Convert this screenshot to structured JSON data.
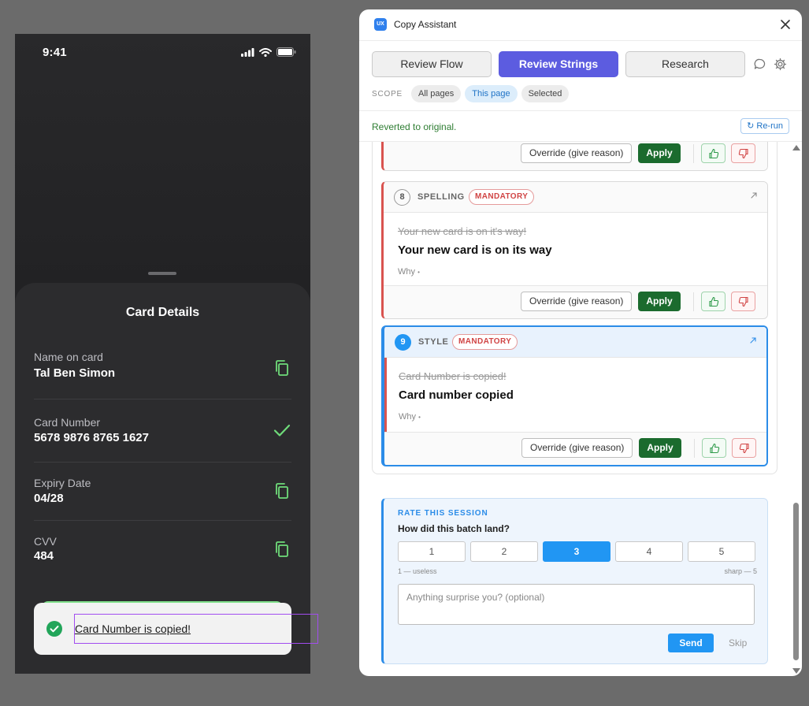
{
  "phone": {
    "status_time": "9:41",
    "sheet_title": "Card Details",
    "rows": [
      {
        "label": "Name on card",
        "value": "Tal Ben Simon",
        "icon": "copy-icon"
      },
      {
        "label": "Card Number",
        "value": "5678 9876 8765 1627",
        "icon": "check-icon"
      },
      {
        "label": "Expiry Date",
        "value": "04/28",
        "icon": "copy-icon"
      },
      {
        "label": "CVV",
        "value": "484",
        "icon": "copy-icon"
      }
    ],
    "toast_text": "Card Number is copied!",
    "accent_color": "#7fe08a"
  },
  "plugin": {
    "app_badge": "UX",
    "title": "Copy Assistant",
    "tabs": [
      {
        "label": "Review Flow",
        "active": false
      },
      {
        "label": "Review Strings",
        "active": true
      },
      {
        "label": "Research",
        "active": false
      }
    ],
    "scope": {
      "label": "SCOPE",
      "chips": [
        {
          "label": "All pages",
          "active": false
        },
        {
          "label": "This page",
          "active": true
        },
        {
          "label": "Selected",
          "active": false
        }
      ]
    },
    "status_message": "Reverted to original.",
    "rerun_label": "Re-run",
    "actions": {
      "override_label": "Override (give reason)",
      "apply_label": "Apply",
      "why_label": "Why",
      "why_dot": "•"
    },
    "items": [
      {
        "number": "8",
        "category": "SPELLING",
        "severity": "MANDATORY",
        "original": "Your new card is on it's way!",
        "suggestion": "Your new card is on its way"
      },
      {
        "number": "9",
        "category": "STYLE",
        "severity": "MANDATORY",
        "original": "Card Number is copied!",
        "suggestion": "Card number copied",
        "selected": true
      }
    ],
    "rating": {
      "title": "RATE THIS SESSION",
      "question": "How did this batch land?",
      "options": [
        "1",
        "2",
        "3",
        "4",
        "5"
      ],
      "selected": "3",
      "min_label": "1 — useless",
      "max_label": "sharp — 5",
      "comment_placeholder": "Anything surprise you? (optional)",
      "send_label": "Send",
      "skip_label": "Skip"
    },
    "colors": {
      "primary_tab": "#5c5ce0",
      "apply": "#1b6b2e",
      "mandatory": "#d04444",
      "selected_border": "#2b8ce8"
    }
  }
}
